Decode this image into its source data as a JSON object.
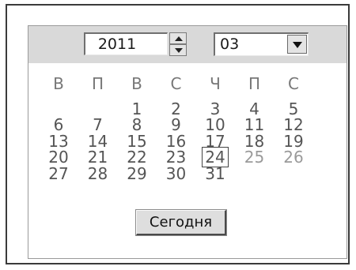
{
  "year": {
    "value": "2011"
  },
  "month": {
    "value": "03"
  },
  "icons": {
    "spin_up": "spin-up-arrow",
    "spin_down": "spin-down-arrow",
    "dropdown": "dropdown-arrow"
  },
  "weekdays": [
    "В",
    "П",
    "В",
    "С",
    "Ч",
    "П",
    "С"
  ],
  "days": [
    [
      "",
      "",
      "1",
      "2",
      "3",
      "4",
      "5"
    ],
    [
      "6",
      "7",
      "8",
      "9",
      "10",
      "11",
      "12"
    ],
    [
      "13",
      "14",
      "15",
      "16",
      "17",
      "18",
      "19"
    ],
    [
      "20",
      "21",
      "22",
      "23",
      "24",
      "25",
      "26"
    ],
    [
      "27",
      "28",
      "29",
      "30",
      "31",
      "",
      ""
    ]
  ],
  "selected_day": "24",
  "today_button": {
    "label": "Сегодня"
  },
  "colors": {
    "header_bar": "#d9d9d9",
    "day_text": "#555555",
    "muted_text": "#9a9a9a"
  }
}
